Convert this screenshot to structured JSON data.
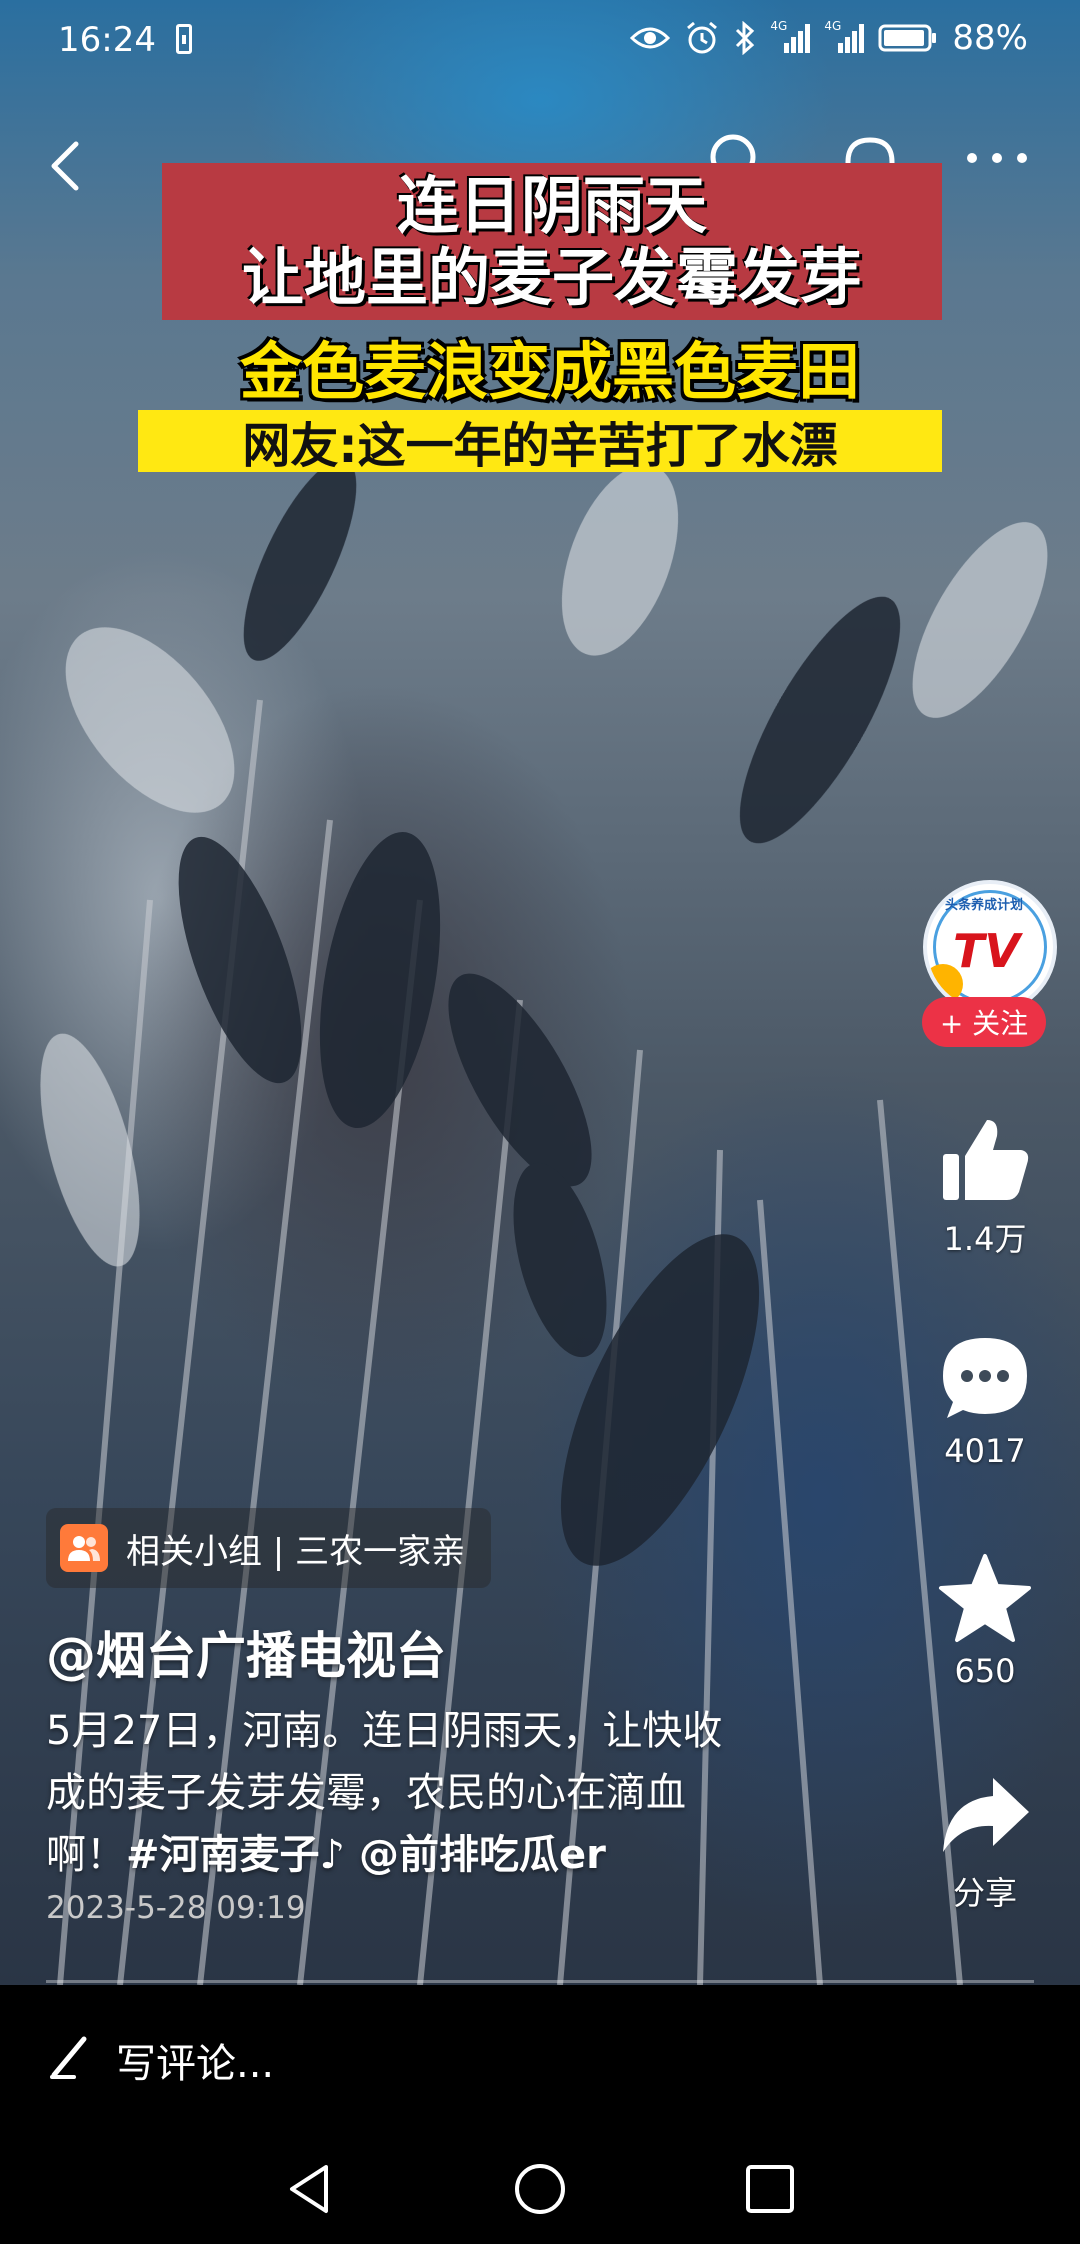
{
  "status_bar": {
    "time": "16:24",
    "battery": "88%",
    "net_label_1": "4G",
    "net_label_2": "4G"
  },
  "captions": {
    "line1": "连日阴雨天",
    "line2": "让地里的麦子发霉发芽",
    "line3": "金色麦浪变成黑色麦田",
    "line4": "网友:这一年的辛苦打了水漂"
  },
  "channel_logo": {
    "logo_text": "TV",
    "arc_text": "头条养成计划"
  },
  "follow_label": "+ 关注",
  "actions": {
    "like_count": "1.4万",
    "comment_count": "4017",
    "favorite_count": "650",
    "share_label": "分享"
  },
  "group_tag": "相关小组 | 三农一家亲",
  "author": "@烟台广播电视台",
  "description": {
    "line1": "5月27日，河南。连日阴雨天，让快收",
    "line2": "成的麦子发芽发霉，农民的心在滴血",
    "line3_prefix": "啊！",
    "hashtag": "#河南麦子",
    "mention": "♪ @前排吃瓜er"
  },
  "date": "2023-5-28 09:19",
  "comment_placeholder": "写评论...",
  "colors": {
    "follow_red": "#ec3246",
    "caption_red": "#b83a42",
    "caption_yellow": "#ffe812",
    "caption_yellow_text": "#ffe600"
  }
}
